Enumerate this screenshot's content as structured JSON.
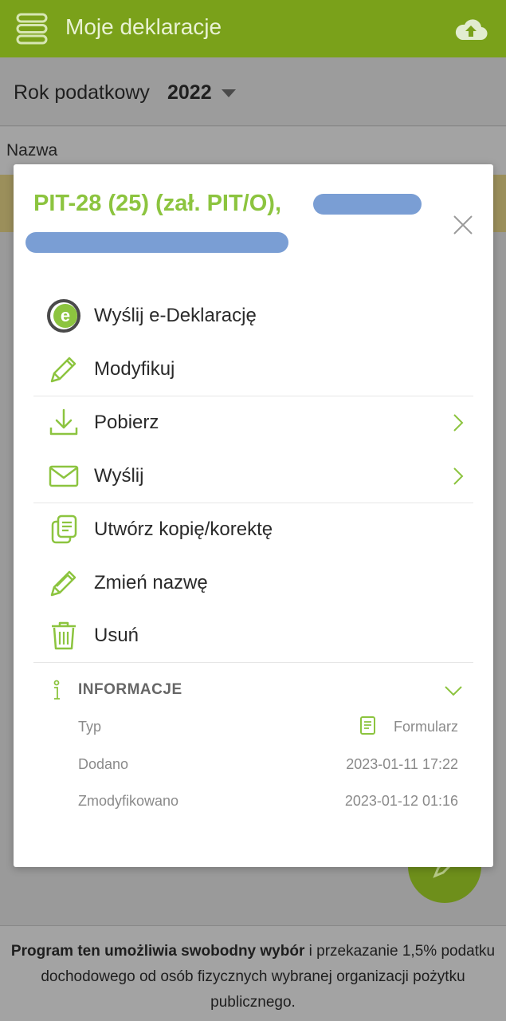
{
  "app": {
    "title": "Moje deklaracje",
    "year_label": "Rok podatkowy",
    "year_value": "2022",
    "column_name": "Nazwa",
    "footer": {
      "bold": "Program ten umożliwia swobodny wybór",
      "rest": " i przekazanie 1,5% podatku dochodowego od osób fizycznych wybranej organizacji pożytku publicznego."
    }
  },
  "modal": {
    "title": "PIT-28 (25) (zał. PIT/O),",
    "actions": [
      {
        "label": "Wyślij e-Deklarację",
        "icon": "e-declaration-icon"
      },
      {
        "label": "Modyfikuj",
        "icon": "pencil-icon"
      },
      {
        "label": "Pobierz",
        "icon": "download-icon"
      },
      {
        "label": "Wyślij",
        "icon": "envelope-icon"
      },
      {
        "label": "Utwórz kopię/korektę",
        "icon": "copy-icon"
      },
      {
        "label": "Zmień nazwę",
        "icon": "rename-icon"
      },
      {
        "label": "Usuń",
        "icon": "trash-icon"
      }
    ],
    "info": {
      "title": "INFORMACJE",
      "rows": [
        {
          "key": "Typ",
          "value": "Formularz"
        },
        {
          "key": "Dodano",
          "value": "2023-01-11 17:22"
        },
        {
          "key": "Zmodyfikowano",
          "value": "2023-01-12 01:16"
        }
      ]
    }
  },
  "colors": {
    "brand_green": "#8cc43f",
    "topbar": "#7aa11a",
    "redaction": "#7a9ed4"
  }
}
